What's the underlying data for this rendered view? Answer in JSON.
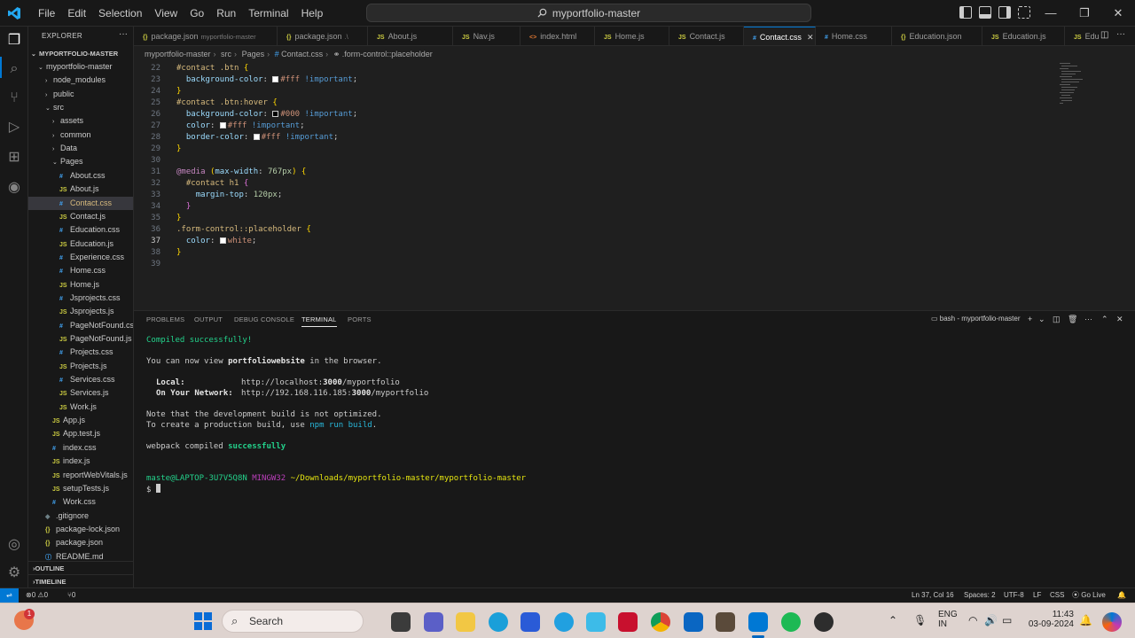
{
  "menu": [
    "File",
    "Edit",
    "Selection",
    "View",
    "Go",
    "Run",
    "Terminal",
    "Help"
  ],
  "command_center": "myportfolio-master",
  "window_controls": {
    "minimize": "—",
    "maximize": "❐",
    "close": "✕"
  },
  "explorer": {
    "title": "EXPLORER",
    "more": "···",
    "root": "MYPORTFOLIO-MASTER",
    "items": [
      {
        "label": "myportfolio-master",
        "type": "folder",
        "depth": 1,
        "open": true
      },
      {
        "label": "node_modules",
        "type": "folder",
        "depth": 2,
        "open": false
      },
      {
        "label": "public",
        "type": "folder",
        "depth": 2,
        "open": false
      },
      {
        "label": "src",
        "type": "folder",
        "depth": 2,
        "open": true
      },
      {
        "label": "assets",
        "type": "folder",
        "depth": 3,
        "open": false
      },
      {
        "label": "common",
        "type": "folder",
        "depth": 3,
        "open": false
      },
      {
        "label": "Data",
        "type": "folder",
        "depth": 3,
        "open": false
      },
      {
        "label": "Pages",
        "type": "folder",
        "depth": 3,
        "open": true
      },
      {
        "label": "About.css",
        "type": "css",
        "depth": 4
      },
      {
        "label": "About.js",
        "type": "js",
        "depth": 4
      },
      {
        "label": "Contact.css",
        "type": "css",
        "depth": 4,
        "selected": true
      },
      {
        "label": "Contact.js",
        "type": "js",
        "depth": 4
      },
      {
        "label": "Education.css",
        "type": "css",
        "depth": 4
      },
      {
        "label": "Education.js",
        "type": "js",
        "depth": 4
      },
      {
        "label": "Experience.css",
        "type": "css",
        "depth": 4
      },
      {
        "label": "Home.css",
        "type": "css",
        "depth": 4
      },
      {
        "label": "Home.js",
        "type": "js",
        "depth": 4
      },
      {
        "label": "Jsprojects.css",
        "type": "css",
        "depth": 4
      },
      {
        "label": "Jsprojects.js",
        "type": "js",
        "depth": 4
      },
      {
        "label": "PageNotFound.css",
        "type": "css",
        "depth": 4
      },
      {
        "label": "PageNotFound.js",
        "type": "js",
        "depth": 4
      },
      {
        "label": "Projects.css",
        "type": "css",
        "depth": 4
      },
      {
        "label": "Projects.js",
        "type": "js",
        "depth": 4
      },
      {
        "label": "Services.css",
        "type": "css",
        "depth": 4
      },
      {
        "label": "Services.js",
        "type": "js",
        "depth": 4
      },
      {
        "label": "Work.js",
        "type": "js",
        "depth": 4
      },
      {
        "label": "App.js",
        "type": "js",
        "depth": 3
      },
      {
        "label": "App.test.js",
        "type": "js",
        "depth": 3
      },
      {
        "label": "index.css",
        "type": "css",
        "depth": 3
      },
      {
        "label": "index.js",
        "type": "js",
        "depth": 3
      },
      {
        "label": "reportWebVitals.js",
        "type": "js",
        "depth": 3
      },
      {
        "label": "setupTests.js",
        "type": "js",
        "depth": 3
      },
      {
        "label": "Work.css",
        "type": "css",
        "depth": 3
      },
      {
        "label": ".gitignore",
        "type": "git",
        "depth": 2
      },
      {
        "label": "package-lock.json",
        "type": "json",
        "depth": 2
      },
      {
        "label": "package.json",
        "type": "json",
        "depth": 2
      },
      {
        "label": "README.md",
        "type": "md",
        "depth": 2
      }
    ],
    "sections": [
      "OUTLINE",
      "TIMELINE"
    ]
  },
  "tabs": [
    {
      "label": "package.json",
      "sub": "myportfolio-master",
      "type": "json"
    },
    {
      "label": "package.json",
      "sub": ".\\",
      "type": "json"
    },
    {
      "label": "About.js",
      "type": "js"
    },
    {
      "label": "Nav.js",
      "type": "js"
    },
    {
      "label": "index.html",
      "type": "html"
    },
    {
      "label": "Home.js",
      "type": "js"
    },
    {
      "label": "Contact.js",
      "type": "js"
    },
    {
      "label": "Contact.css",
      "type": "css",
      "active": true
    },
    {
      "label": "Home.css",
      "type": "css"
    },
    {
      "label": "Education.json",
      "type": "json"
    },
    {
      "label": "Education.js",
      "type": "js"
    },
    {
      "label": "Edu",
      "type": "js"
    }
  ],
  "breadcrumb": [
    "myportfolio-master",
    "src",
    "Pages",
    "Contact.css",
    ".form-control::placeholder"
  ],
  "code": {
    "line_numbers": [
      "22",
      "23",
      "24",
      "25",
      "26",
      "27",
      "28",
      "29",
      "30",
      "31",
      "32",
      "33",
      "34",
      "35",
      "36",
      "37",
      "38",
      "39"
    ],
    "l22_sel": "#contact .btn",
    "l23_prop": "background-color",
    "l23_val": "#fff",
    "l25_sel": "#contact .btn:hover",
    "l26_prop": "background-color",
    "l26_val": "#000",
    "l27_prop": "color",
    "l27_val": "#fff",
    "l28_prop": "border-color",
    "l28_val": "#fff",
    "important": "!important",
    "l31_at": "@media",
    "l31_feat": "max-width",
    "l31_num": "767px",
    "l32_sel": "#contact h1",
    "l33_prop": "margin-top",
    "l33_num": "120px",
    "l36_sel": ".form-control::placeholder",
    "l37_prop": "color",
    "l37_val": "white"
  },
  "panel": {
    "tabs": [
      "PROBLEMS",
      "OUTPUT",
      "DEBUG CONSOLE",
      "TERMINAL",
      "PORTS"
    ],
    "active_tab": "TERMINAL",
    "shell": "bash - myportfolio-master",
    "terminal": {
      "compiled": "Compiled successfully!",
      "view_pre": "You can now view ",
      "app_name": "portfoliowebsite",
      "view_post": " in the browser.",
      "local_label": "Local:",
      "local_url_pre": "http://localhost:",
      "local_port": "3000",
      "local_url_post": "/myportfolio",
      "network_label": "On Your Network:",
      "network_url_pre": "http://192.168.116.185:",
      "network_port": "3000",
      "network_url_post": "/myportfolio",
      "note1": "Note that the development build is not optimized.",
      "note2_pre": "To create a production build, use ",
      "note2_cmd": "npm run build",
      "note2_post": ".",
      "webpack_pre": "webpack compiled ",
      "webpack_ok": "successfully",
      "prompt_user": "maste@LAPTOP-3U7V5Q8N",
      "prompt_env": "MINGW32",
      "prompt_path": "~/Downloads/myportfolio-master/myportfolio-master",
      "prompt_symbol": "$"
    }
  },
  "status": {
    "errors": "0",
    "warnings": "0",
    "ports": "0",
    "position": "Ln 37, Col 16",
    "spaces": "Spaces: 2",
    "encoding": "UTF-8",
    "eol": "LF",
    "language": "CSS",
    "golive": "Go Live"
  },
  "taskbar": {
    "search": "Search",
    "notification_count": "1",
    "lang1": "ENG",
    "lang2": "IN",
    "time": "11:43",
    "date": "03-09-2024"
  },
  "colors": {
    "accent": "#0078d4",
    "editor_bg": "#1f1f1f",
    "sidebar_bg": "#181818",
    "taskbar_bg": "#ded3cf"
  }
}
